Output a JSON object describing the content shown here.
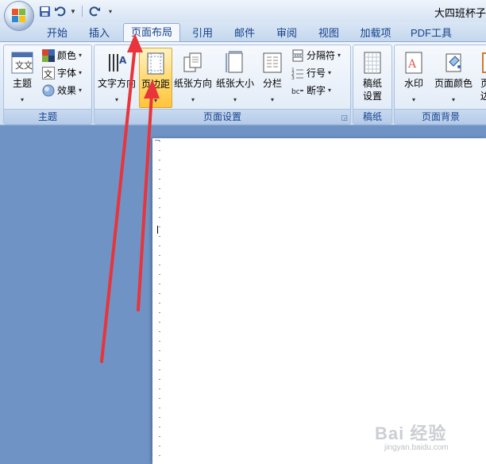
{
  "window": {
    "title": "大四班杯子"
  },
  "quick_access": {
    "icons": [
      "save-icon",
      "undo-icon",
      "redo-icon"
    ]
  },
  "tabs": [
    {
      "label": "开始"
    },
    {
      "label": "插入"
    },
    {
      "label": "页面布局",
      "active": true
    },
    {
      "label": "引用"
    },
    {
      "label": "邮件"
    },
    {
      "label": "审阅"
    },
    {
      "label": "视图"
    },
    {
      "label": "加载项"
    },
    {
      "label": "PDF工具"
    }
  ],
  "ribbon": {
    "theme_group": {
      "label": "主题",
      "themes_label": "主题",
      "colors_label": "颜色",
      "fonts_label": "字体",
      "effects_label": "效果"
    },
    "page_setup_group": {
      "label": "页面设置",
      "text_direction_label": "文字方向",
      "margins_label": "页边距",
      "orientation_label": "纸张方向",
      "size_label": "纸张大小",
      "columns_label": "分栏",
      "breaks_label": "分隔符",
      "line_numbers_label": "行号",
      "hyphenation_label": "断字"
    },
    "manuscript_group": {
      "label": "稿纸",
      "settings_label_1": "稿纸",
      "settings_label_2": "设置"
    },
    "page_background_group": {
      "label": "页面背景",
      "watermark_label": "水印",
      "page_color_label": "页面颜色",
      "page_borders_label_1": "页",
      "page_borders_label_2": "边"
    }
  },
  "watermark": {
    "line1": "Bai 经验",
    "line2": "jingyan.baidu.com"
  },
  "colors": {
    "annotation_arrow": "#e8343a",
    "highlight": "#ffd86e",
    "tab_text": "#15428b"
  }
}
